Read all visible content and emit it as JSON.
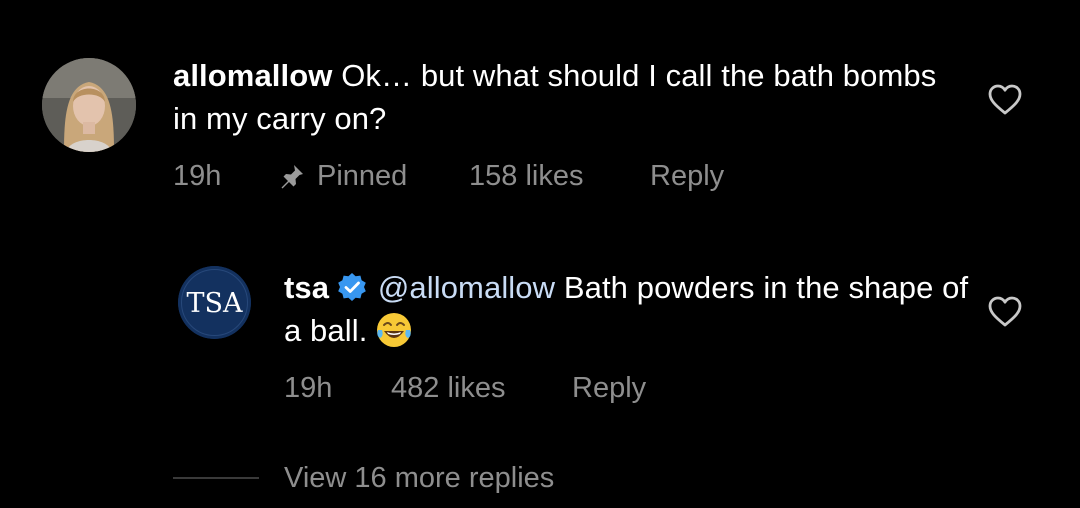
{
  "comment": {
    "username": "allomallow",
    "text": "Ok… but what should I call the bath bombs in my carry on?",
    "time": "19h",
    "pinned_label": "Pinned",
    "likes": "158 likes",
    "reply_label": "Reply",
    "icons": {
      "pin": "pin-icon",
      "like": "heart-icon"
    }
  },
  "reply": {
    "username": "tsa",
    "avatar_text": "TSA",
    "verified": true,
    "mention": "@allomallow",
    "text": "Bath powders in the shape of a ball.",
    "time": "19h",
    "likes": "482 likes",
    "reply_label": "Reply",
    "icons": {
      "verified": "verified-badge-icon",
      "emoji": "tears-of-joy-emoji",
      "like": "heart-icon"
    }
  },
  "view_more_label": "View 16 more replies",
  "colors": {
    "background": "#000000",
    "primary_text": "#ffffff",
    "secondary_text": "#8e8e8e",
    "verified_blue": "#3897f0",
    "tsa_navy": "#13315f"
  }
}
